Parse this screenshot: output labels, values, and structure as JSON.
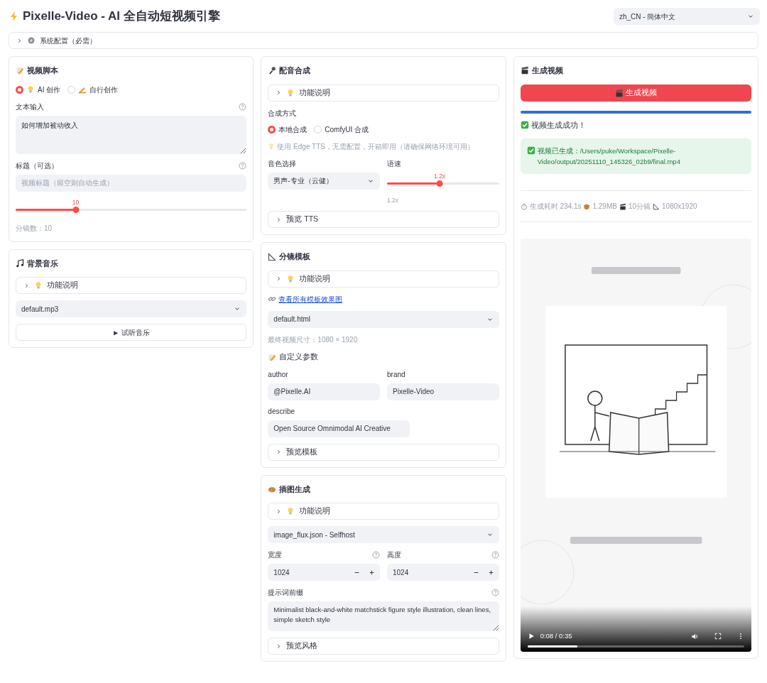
{
  "header": {
    "title": "Pixelle-Video - AI 全自动短视频引擎",
    "language": "zh_CN - 簡体中文"
  },
  "system_config": {
    "label": "系统配置（必需）",
    "expanded": false
  },
  "script_panel": {
    "title": "视频脚本",
    "modes": [
      {
        "label": "AI 创作",
        "selected": true
      },
      {
        "label": "自行创作",
        "selected": false
      }
    ],
    "text_label": "文本输入",
    "text_value": "如何增加被动收入",
    "title_label": "标题（可选）",
    "title_placeholder": "视频标题（留空则自动生成）",
    "scenes_slider": {
      "reading": "10",
      "level": 0.26
    },
    "scene_count": "分镜数：10"
  },
  "music_panel": {
    "title": "背景音乐",
    "help": {
      "label": "功能说明",
      "expanded": false
    },
    "track": "default.mp3",
    "play_button": "► 试听音乐"
  },
  "tts_panel": {
    "title": "配音合成",
    "help": {
      "label": "功能说明",
      "expanded": false
    },
    "method_label": "合成方式",
    "methods": [
      {
        "label": "本地合成",
        "selected": true
      },
      {
        "label": "ComfyUI 合成",
        "selected": false
      }
    ],
    "hint": "使用 Edge TTS，无需配置，开箱即用（请确保网络环境可用）",
    "voice_label": "音色选择",
    "voice": "男声-专业（云健）",
    "speed_label": "语速",
    "speed_slider": {
      "reading": "1.2x",
      "level": 0.47
    },
    "speed_caption": "1.2x",
    "preview": {
      "label": "预览 TTS",
      "expanded": false
    }
  },
  "template_panel": {
    "title": "分镜模板",
    "help": {
      "label": "功能说明",
      "expanded": false
    },
    "link": "查看所有模板效果图",
    "template": "default.html",
    "size_note": "最终视频尺寸：1080 × 1920",
    "params_title": "自定义参数",
    "params": [
      {
        "label": "author",
        "value": "@Pixelle.AI"
      },
      {
        "label": "brand",
        "value": "Pixelle-Video"
      },
      {
        "label": "describe",
        "value": "Open Source Omnimodal AI Creative"
      }
    ],
    "preview": {
      "label": "预览模板",
      "expanded": false
    }
  },
  "image_panel": {
    "title": "插图生成",
    "help": {
      "label": "功能说明",
      "expanded": false
    },
    "workflow": "image_flux.json - Selfhost",
    "sizes": [
      {
        "label": "宽度",
        "value": "1024"
      },
      {
        "label": "高度",
        "value": "1024"
      }
    ],
    "prompt_label": "提示词前缀",
    "prompt": "Minimalist black-and-white matchstick figure style illustration, clean lines, simple sketch style",
    "preview": {
      "label": "预览风格",
      "expanded": false
    }
  },
  "output_panel": {
    "title": "生成视频",
    "generate_button": "生成视频",
    "progress": {
      "level": 1
    },
    "status": "视频生成成功！",
    "saved_message": "视频已生成：/Users/puke/Workspace/Pixelle-Video/output/20251110_145326_02b9/final.mp4",
    "stats": [
      "生成耗时 234.1s",
      "1.29MB",
      "10分镜",
      "1080x1920"
    ],
    "video": {
      "kind": "picture",
      "time": "0:08 / 0:35",
      "level": 0.23
    }
  }
}
